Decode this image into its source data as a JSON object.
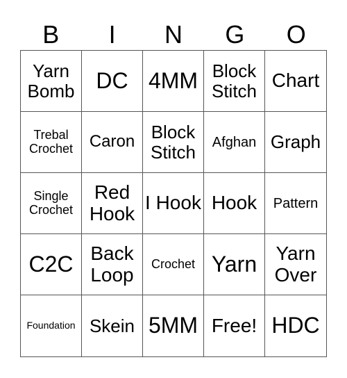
{
  "header": [
    "B",
    "I",
    "N",
    "G",
    "O"
  ],
  "cells": [
    [
      "Yarn Bomb",
      "DC",
      "4MM",
      "Block Stitch",
      "Chart"
    ],
    [
      "Trebal Crochet",
      "Caron",
      "Block Stitch",
      "Afghan",
      "Graph"
    ],
    [
      "Single Crochet",
      "Red Hook",
      "I Hook",
      "Hook",
      "Pattern"
    ],
    [
      "C2C",
      "Back Loop",
      "Crochet",
      "Yarn",
      "Yarn Over"
    ],
    [
      "Foundation",
      "Skein",
      "5MM",
      "Free!",
      "HDC"
    ]
  ]
}
